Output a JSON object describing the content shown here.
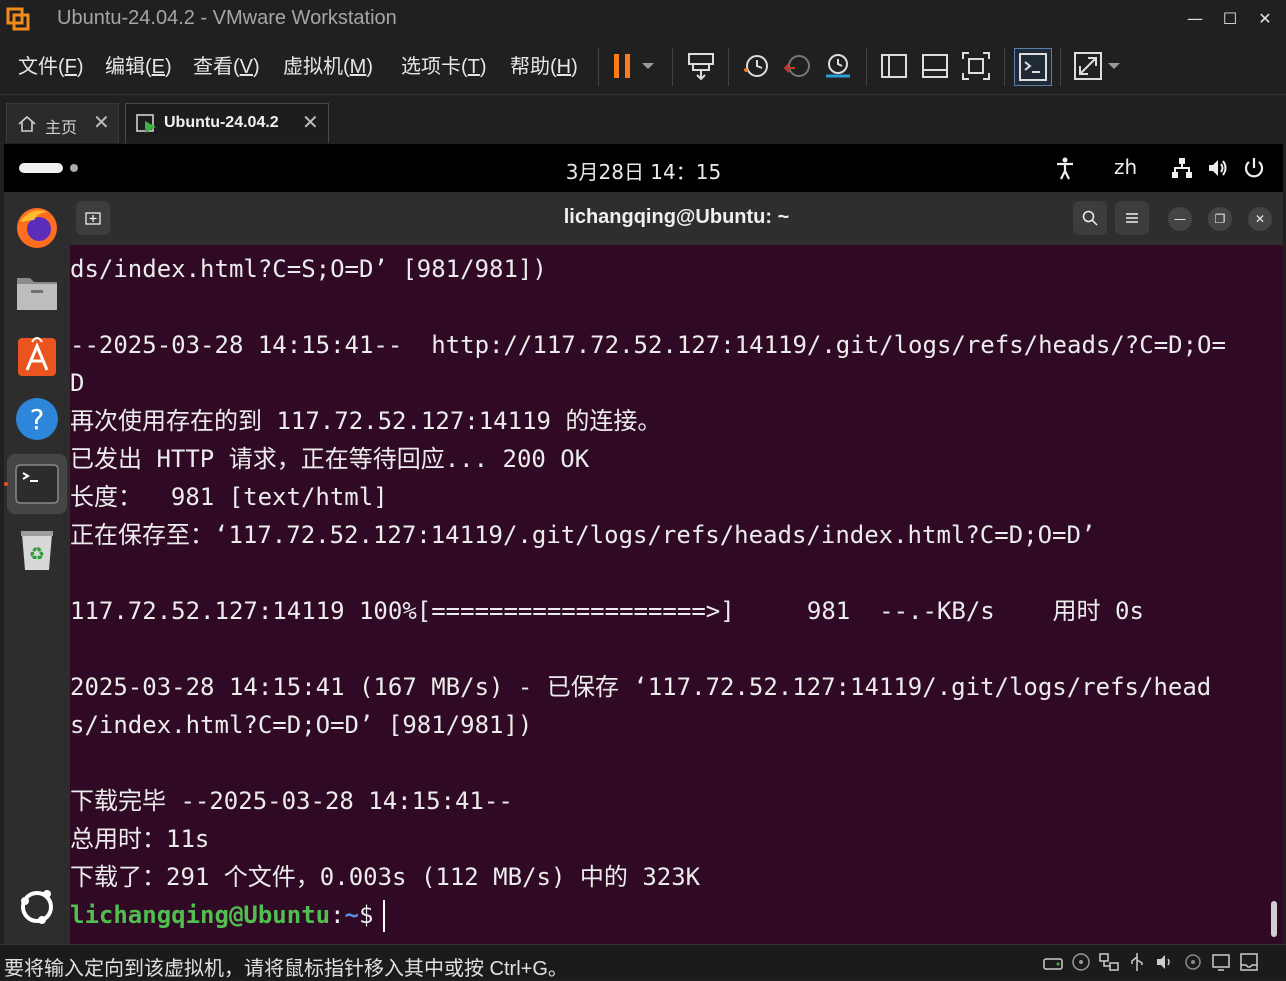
{
  "window": {
    "title": "Ubuntu-24.04.2 - VMware Workstation",
    "minimize": "—",
    "maximize": "☐",
    "close": "✕"
  },
  "menu": [
    {
      "label": "文件(",
      "key": "F",
      "end": ")"
    },
    {
      "label": "编辑(",
      "key": "E",
      "end": ")"
    },
    {
      "label": "查看(",
      "key": "V",
      "end": ")"
    },
    {
      "label": "虚拟机(",
      "key": "M",
      "end": ")"
    },
    {
      "label": "选项卡(",
      "key": "T",
      "end": ")"
    },
    {
      "label": "帮助(",
      "key": "H",
      "end": ")"
    }
  ],
  "tabs": [
    {
      "label": "主页",
      "icon": "home-icon"
    },
    {
      "label": "Ubuntu-24.04.2",
      "icon": "vm-running-icon"
    }
  ],
  "gnome": {
    "clock": "3月28日  14：15",
    "lang": "zh"
  },
  "terminal": {
    "title": "lichangqing@Ubuntu: ~",
    "lines": [
      "ds/index.html?C=S;O=D’ [981/981])",
      "",
      "--2025-03-28 14:15:41--  http://117.72.52.127:14119/.git/logs/refs/heads/?C=D;O=",
      "D",
      "再次使用存在的到 117.72.52.127:14119 的连接。",
      "已发出 HTTP 请求，正在等待回应... 200 OK",
      "长度：  981 [text/html]",
      "正在保存至：‘117.72.52.127:14119/.git/logs/refs/heads/index.html?C=D;O=D’",
      "",
      "117.72.52.127:14119 100%[===================>]     981  --.-KB/s    用时 0s",
      "",
      "2025-03-28 14:15:41 (167 MB/s) - 已保存 ‘117.72.52.127:14119/.git/logs/refs/head",
      "s/index.html?C=D;O=D’ [981/981])",
      "",
      "下载完毕 --2025-03-28 14:15:41--",
      "总用时：11s",
      "下载了：291 个文件，0.003s (112 MB/s) 中的 323K"
    ],
    "prompt_user": "lichangqing@Ubuntu",
    "prompt_sep": ":",
    "prompt_path": "~",
    "prompt_symbol": "$"
  },
  "status": {
    "text": "要将输入定向到该虚拟机，请将鼠标指针移入其中或按 Ctrl+G。"
  },
  "colors": {
    "terminal_bg": "#300a24",
    "prompt_user": "#4fbf4f",
    "prompt_path": "#5a8de0",
    "pause_accent": "#ff7a1a"
  }
}
